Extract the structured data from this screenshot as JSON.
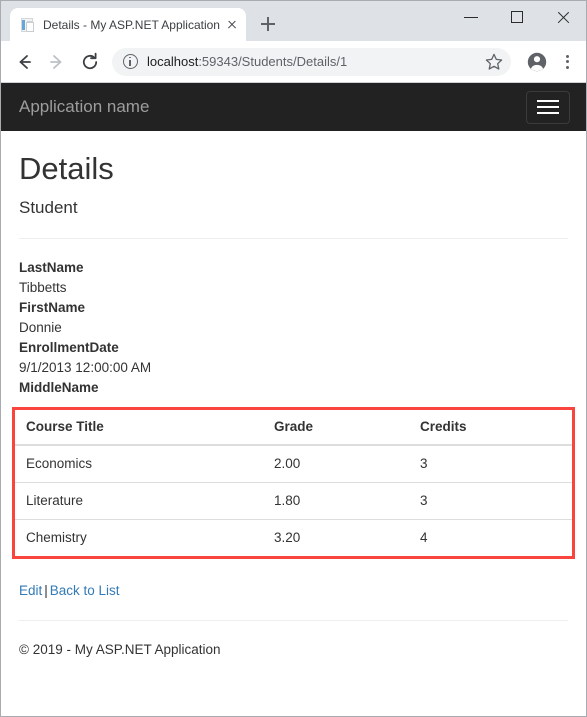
{
  "browser": {
    "tab": {
      "title": "Details - My ASP.NET Application",
      "favicon": "document-icon",
      "close_icon": "close-icon"
    },
    "new_tab_icon": "plus-icon",
    "window_controls": {
      "minimize": "minimize-icon",
      "maximize": "maximize-icon",
      "close": "close-icon"
    },
    "toolbar": {
      "back_icon": "arrow-left-icon",
      "forward_icon": "arrow-right-icon",
      "reload_icon": "reload-icon",
      "site_info_icon": "info-circle-icon",
      "url_host": "localhost",
      "url_rest": ":59343/Students/Details/1",
      "bookmark_icon": "star-icon",
      "profile_icon": "account-circle-icon",
      "menu_icon": "three-dot-menu-icon"
    }
  },
  "page": {
    "navbar": {
      "brand": "Application name",
      "toggle_icon": "hamburger-menu-icon"
    },
    "title": "Details",
    "subtitle": "Student",
    "details": [
      {
        "label": "LastName",
        "value": "Tibbetts"
      },
      {
        "label": "FirstName",
        "value": "Donnie"
      },
      {
        "label": "EnrollmentDate",
        "value": "9/1/2013 12:00:00 AM"
      },
      {
        "label": "MiddleName",
        "value": ""
      }
    ],
    "courses_table": {
      "highlight_color": "#f9453e",
      "headers": [
        "Course Title",
        "Grade",
        "Credits"
      ],
      "rows": [
        [
          "Economics",
          "2.00",
          "3"
        ],
        [
          "Literature",
          "1.80",
          "3"
        ],
        [
          "Chemistry",
          "3.20",
          "4"
        ]
      ]
    },
    "actions": {
      "edit": "Edit",
      "separator": "|",
      "back": "Back to List"
    },
    "footer": "© 2019 - My ASP.NET Application"
  }
}
